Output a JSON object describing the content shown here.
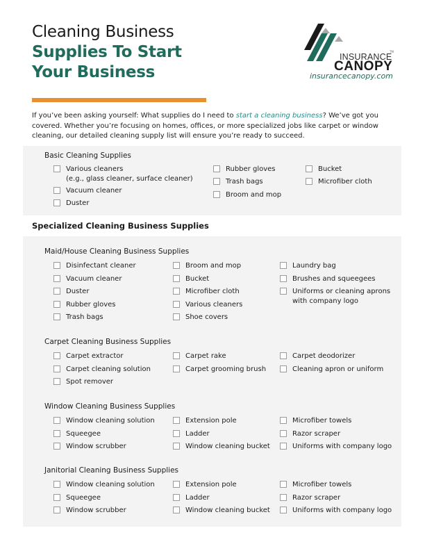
{
  "header": {
    "title_line1": "Cleaning Business",
    "title_line2": "Supplies To Start",
    "title_line3": "Your Business"
  },
  "logo": {
    "word1": "INSURANCE",
    "word2": "CANOPY",
    "reg": "TM",
    "url": "insurancecanopy.com"
  },
  "colors": {
    "brand_green": "#1f6b5c",
    "accent_orange": "#e8902f",
    "link_teal": "#2a8a86",
    "panel_gray": "#f3f3f3"
  },
  "intro": {
    "before_link": "If you’ve been asking yourself: What supplies do I need to ",
    "link_text": "start a cleaning business",
    "after_link": "? We’ve got you covered. Whether you’re focusing on homes, offices, or more specialized jobs like carpet or window cleaning, our detailed cleaning supply list will ensure you’re ready to succeed."
  },
  "basic": {
    "title": "Basic Cleaning Supplies",
    "col1": [
      {
        "label": "Various cleaners",
        "label2": "(e.g., glass cleaner, surface cleaner)",
        "checked": false
      },
      {
        "label": "Vacuum cleaner",
        "checked": false
      },
      {
        "label": "Duster",
        "checked": false
      }
    ],
    "col2": [
      {
        "label": "Rubber gloves",
        "checked": false
      },
      {
        "label": "Trash bags",
        "checked": false
      },
      {
        "label": "Broom and mop",
        "checked": false
      }
    ],
    "col3": [
      {
        "label": "Bucket",
        "checked": false
      },
      {
        "label": "Microfiber cloth",
        "checked": false
      }
    ]
  },
  "specialized_heading": "Specialized Cleaning Business Supplies",
  "groups": [
    {
      "title": "Maid/House Cleaning Business Supplies",
      "col1": [
        "Disinfectant cleaner",
        "Vacuum cleaner",
        "Duster",
        "Rubber gloves",
        "Trash bags"
      ],
      "col2": [
        "Broom and mop",
        "Bucket",
        "Microfiber cloth",
        "Various cleaners",
        "Shoe covers"
      ],
      "col3": [
        "Laundry bag",
        "Brushes and squeegees",
        "Uniforms or cleaning aprons"
      ],
      "col3_extra_line": "with company logo"
    },
    {
      "title": "Carpet Cleaning Business Supplies",
      "col1": [
        "Carpet extractor",
        "Carpet cleaning solution",
        "Spot remover"
      ],
      "col2": [
        "Carpet rake",
        "Carpet grooming brush"
      ],
      "col3": [
        "Carpet deodorizer",
        "Cleaning apron or uniform"
      ]
    },
    {
      "title": "Window Cleaning Business Supplies",
      "col1": [
        "Window cleaning solution",
        "Squeegee",
        "Window scrubber"
      ],
      "col2": [
        "Extension pole",
        "Ladder",
        "Window cleaning bucket"
      ],
      "col3": [
        "Microfiber towels",
        "Razor scraper",
        "Uniforms with company logo"
      ]
    },
    {
      "title": "Janitorial Cleaning Business Supplies",
      "col1": [
        "Window cleaning solution",
        "Squeegee",
        "Window scrubber"
      ],
      "col2": [
        "Extension pole",
        "Ladder",
        "Window cleaning bucket"
      ],
      "col3": [
        "Microfiber towels",
        "Razor scraper",
        "Uniforms with company logo"
      ]
    }
  ]
}
